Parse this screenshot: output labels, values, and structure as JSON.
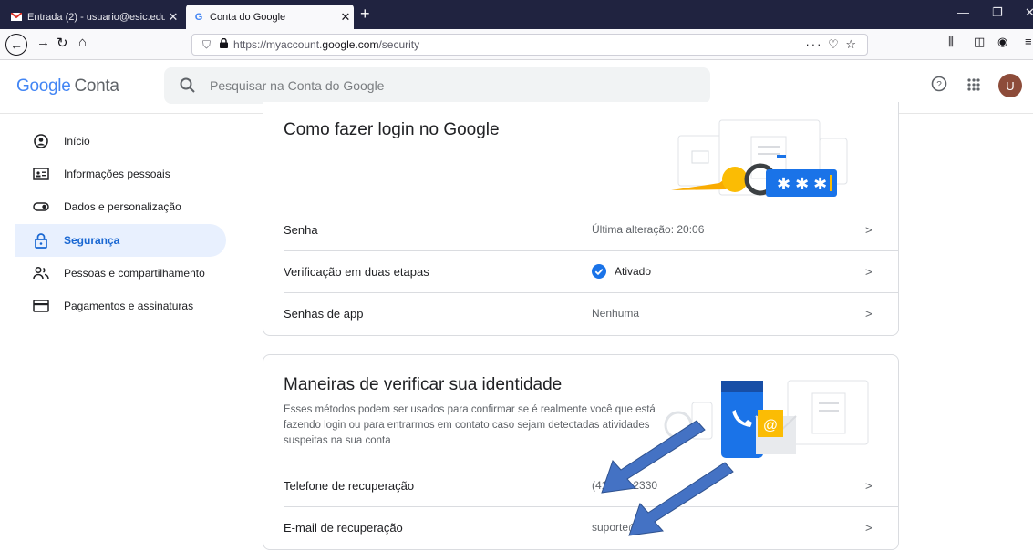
{
  "browser": {
    "tabs": [
      {
        "title": "Entrada (2) - usuario@esic.edu",
        "close": "✕"
      },
      {
        "title": "Conta do Google",
        "close": "✕"
      }
    ],
    "new_tab": "+",
    "url_prefix": "https://myaccount.",
    "url_domain": "google.com",
    "url_path": "/security",
    "url_actions": "··· ♡ ☆"
  },
  "header": {
    "logo_google": "Google",
    "logo_conta": "Conta",
    "search_placeholder": "Pesquisar na Conta do Google",
    "avatar_letter": "U"
  },
  "sidebar": {
    "items": [
      {
        "label": "Início"
      },
      {
        "label": "Informações pessoais"
      },
      {
        "label": "Dados e personalização"
      },
      {
        "label": "Segurança"
      },
      {
        "label": "Pessoas e compartilhamento"
      },
      {
        "label": "Pagamentos e assinaturas"
      }
    ]
  },
  "login_card": {
    "title": "Como fazer login no Google",
    "rows": [
      {
        "label": "Senha",
        "value": "Última alteração: 20:06"
      },
      {
        "label": "Verificação em duas etapas",
        "value": "Ativado"
      },
      {
        "label": "Senhas de app",
        "value": "Nenhuma"
      }
    ]
  },
  "identity_card": {
    "title": "Maneiras de verificar sua identidade",
    "description": "Esses métodos podem ser usados para confirmar se é realmente você que está fazendo login ou para entrarmos em contato caso sejam detectadas atividades suspeitas na sua conta",
    "rows": [
      {
        "label": "Telefone de recuperação",
        "value": "(41) 9    9-2330"
      },
      {
        "label": "E-mail de recuperação",
        "value": "suporte@es"
      }
    ]
  },
  "colors": {
    "accent": "#1a73e8",
    "active_bg": "#e8f0fe",
    "arrow": "#4472c4",
    "tabbar": "#202340"
  }
}
